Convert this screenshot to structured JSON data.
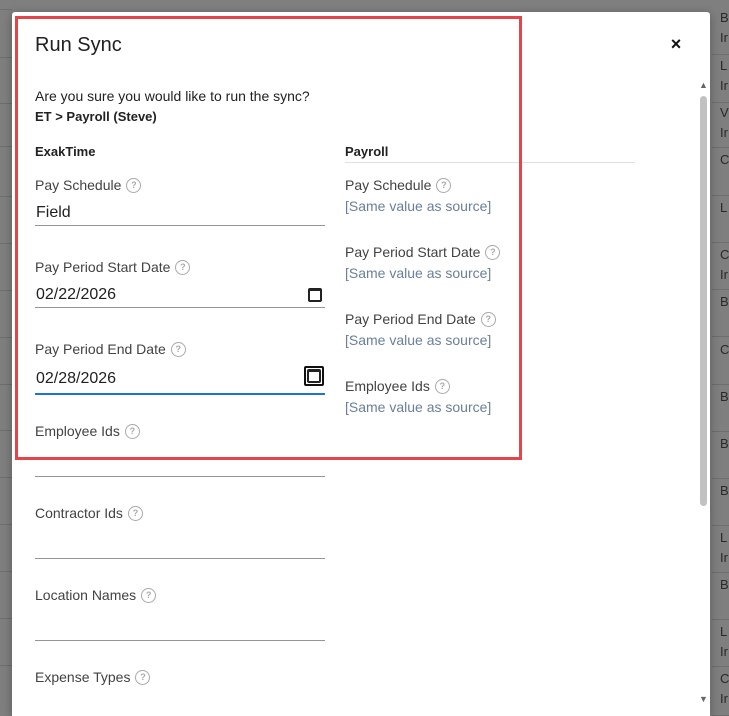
{
  "modal": {
    "title": "Run Sync",
    "close_label": "×",
    "confirm_text": "Are you sure you would like to run the sync?",
    "sync_name": "ET > Payroll (Steve)"
  },
  "source": {
    "heading": "ExakTime",
    "fields": [
      {
        "label": "Pay Schedule",
        "value": "Field"
      },
      {
        "label": "Pay Period Start Date",
        "value": "02/22/2026"
      },
      {
        "label": "Pay Period End Date",
        "value": "02/28/2026"
      },
      {
        "label": "Employee Ids",
        "value": ""
      },
      {
        "label": "Contractor Ids",
        "value": ""
      },
      {
        "label": "Location Names",
        "value": ""
      },
      {
        "label": "Expense Types",
        "value": ""
      }
    ]
  },
  "target": {
    "heading": "Payroll",
    "fields": [
      {
        "label": "Pay Schedule",
        "value": "[Same value as source]"
      },
      {
        "label": "Pay Period Start Date",
        "value": "[Same value as source]"
      },
      {
        "label": "Pay Period End Date",
        "value": "[Same value as source]"
      },
      {
        "label": "Employee Ids",
        "value": "[Same value as source]"
      }
    ]
  },
  "help_glyph": "?",
  "background": {
    "right_column": [
      "B",
      "Ir",
      "L",
      "Ir",
      "V",
      "Ir",
      "C",
      "L",
      "C",
      "Ir",
      "B",
      "C",
      "B",
      "B",
      "B",
      "L",
      "Ir",
      "B",
      "L",
      "Ir",
      "C",
      "Ir"
    ]
  },
  "colors": {
    "accent": "#1976d2",
    "highlight": "#e5454a",
    "secondary_value": "#6a7f9a"
  }
}
